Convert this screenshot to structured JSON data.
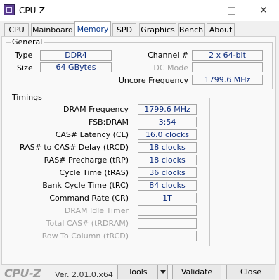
{
  "window": {
    "title": "CPU-Z"
  },
  "tabs": [
    {
      "label": "CPU"
    },
    {
      "label": "Mainboard"
    },
    {
      "label": "Memory"
    },
    {
      "label": "SPD"
    },
    {
      "label": "Graphics"
    },
    {
      "label": "Bench"
    },
    {
      "label": "About"
    }
  ],
  "active_tab": "Memory",
  "general": {
    "group_label": "General",
    "type_label": "Type",
    "type_value": "DDR4",
    "size_label": "Size",
    "size_value": "64 GBytes",
    "channel_label": "Channel #",
    "channel_value": "2 x 64-bit",
    "dc_mode_label": "DC Mode",
    "dc_mode_value": "",
    "uncore_label": "Uncore Frequency",
    "uncore_value": "1799.6 MHz"
  },
  "timings": {
    "group_label": "Timings",
    "rows": [
      {
        "label": "DRAM Frequency",
        "value": "1799.6 MHz",
        "enabled": true
      },
      {
        "label": "FSB:DRAM",
        "value": "3:54",
        "enabled": true
      },
      {
        "label": "CAS# Latency (CL)",
        "value": "16.0 clocks",
        "enabled": true
      },
      {
        "label": "RAS# to CAS# Delay (tRCD)",
        "value": "18 clocks",
        "enabled": true
      },
      {
        "label": "RAS# Precharge (tRP)",
        "value": "18 clocks",
        "enabled": true
      },
      {
        "label": "Cycle Time (tRAS)",
        "value": "36 clocks",
        "enabled": true
      },
      {
        "label": "Bank Cycle Time (tRC)",
        "value": "84 clocks",
        "enabled": true
      },
      {
        "label": "Command Rate (CR)",
        "value": "1T",
        "enabled": true
      },
      {
        "label": "DRAM Idle Timer",
        "value": "",
        "enabled": false
      },
      {
        "label": "Total CAS# (tRDRAM)",
        "value": "",
        "enabled": false
      },
      {
        "label": "Row To Column (tRCD)",
        "value": "",
        "enabled": false
      }
    ]
  },
  "footer": {
    "logo": "CPU-Z",
    "version": "Ver. 2.01.0.x64",
    "tools_label": "Tools",
    "validate_label": "Validate",
    "close_label": "Close"
  },
  "colors": {
    "value_text": "#0a2a7a",
    "active_tab_text": "#0a3a8e",
    "disabled_label": "#a0a0a0"
  }
}
